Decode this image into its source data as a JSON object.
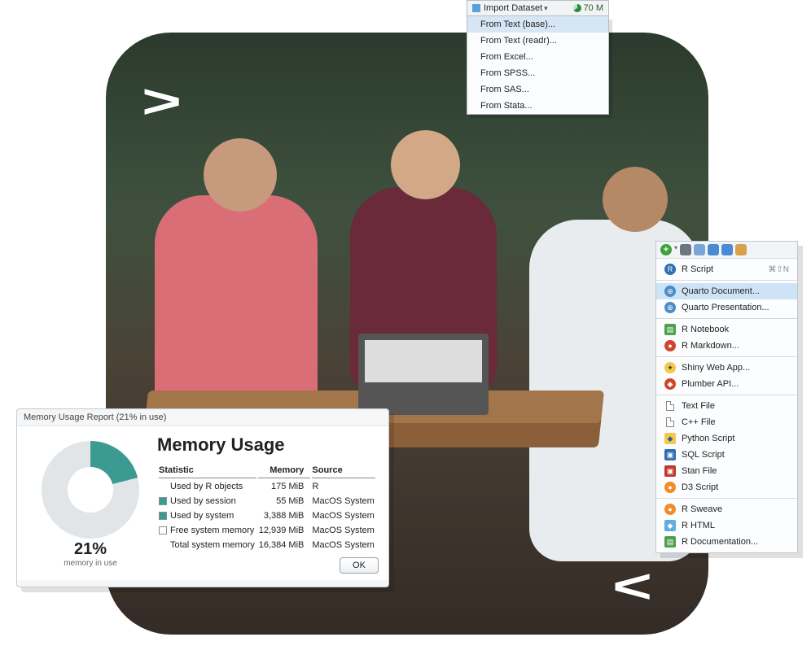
{
  "decor": {
    "chevron_tl": ">",
    "chevron_br": "<"
  },
  "import_menu": {
    "button_label": "Import Dataset",
    "memory_badge": "70 M",
    "items": [
      "From Text (base)...",
      "From Text (readr)...",
      "From Excel...",
      "From SPSS...",
      "From SAS...",
      "From Stata..."
    ],
    "highlighted_index": 0
  },
  "memory_window": {
    "titlebar": "Memory Usage Report (21% in use)",
    "heading": "Memory Usage",
    "percent_label": "21%",
    "percent_sub": "memory in use",
    "percent_value": 21,
    "ok_label": "OK",
    "columns": {
      "statistic": "Statistic",
      "memory": "Memory",
      "source": "Source"
    },
    "rows": [
      {
        "swatch": null,
        "statistic": "Used by R objects",
        "memory": "175 MiB",
        "source": "R"
      },
      {
        "swatch": "#3b9a91",
        "statistic": "Used by session",
        "memory": "55 MiB",
        "source": "MacOS System"
      },
      {
        "swatch": "#3b9a91",
        "statistic": "Used by system",
        "memory": "3,388 MiB",
        "source": "MacOS System"
      },
      {
        "swatch": "#ffffff",
        "statistic": "Free system memory",
        "memory": "12,939 MiB",
        "source": "MacOS System"
      },
      {
        "swatch": null,
        "statistic": "Total system memory",
        "memory": "16,384 MiB",
        "source": "MacOS System"
      }
    ]
  },
  "new_file_menu": {
    "toolbar_icons": [
      "plus-circle-icon",
      "gear-icon",
      "branch-icon",
      "disk-icon",
      "disks-icon",
      "print-icon"
    ],
    "shortcut_r_script": "⌘⇧N",
    "groups": [
      [
        {
          "icon": "r-blue",
          "label": "R Script",
          "shortcut": "⌘⇧N"
        }
      ],
      [
        {
          "icon": "quarto",
          "label": "Quarto Document...",
          "highlight": true
        },
        {
          "icon": "quarto",
          "label": "Quarto Presentation..."
        }
      ],
      [
        {
          "icon": "notebook",
          "label": "R Notebook"
        },
        {
          "icon": "rmd",
          "label": "R Markdown..."
        }
      ],
      [
        {
          "icon": "shiny",
          "label": "Shiny Web App..."
        },
        {
          "icon": "plumber",
          "label": "Plumber API..."
        }
      ],
      [
        {
          "icon": "text",
          "label": "Text File"
        },
        {
          "icon": "cpp",
          "label": "C++ File"
        },
        {
          "icon": "python",
          "label": "Python Script"
        },
        {
          "icon": "sql",
          "label": "SQL Script"
        },
        {
          "icon": "stan",
          "label": "Stan File"
        },
        {
          "icon": "d3",
          "label": "D3 Script"
        }
      ],
      [
        {
          "icon": "sweave",
          "label": "R Sweave"
        },
        {
          "icon": "rhtml",
          "label": "R HTML"
        },
        {
          "icon": "rdoc",
          "label": "R Documentation..."
        }
      ]
    ]
  }
}
